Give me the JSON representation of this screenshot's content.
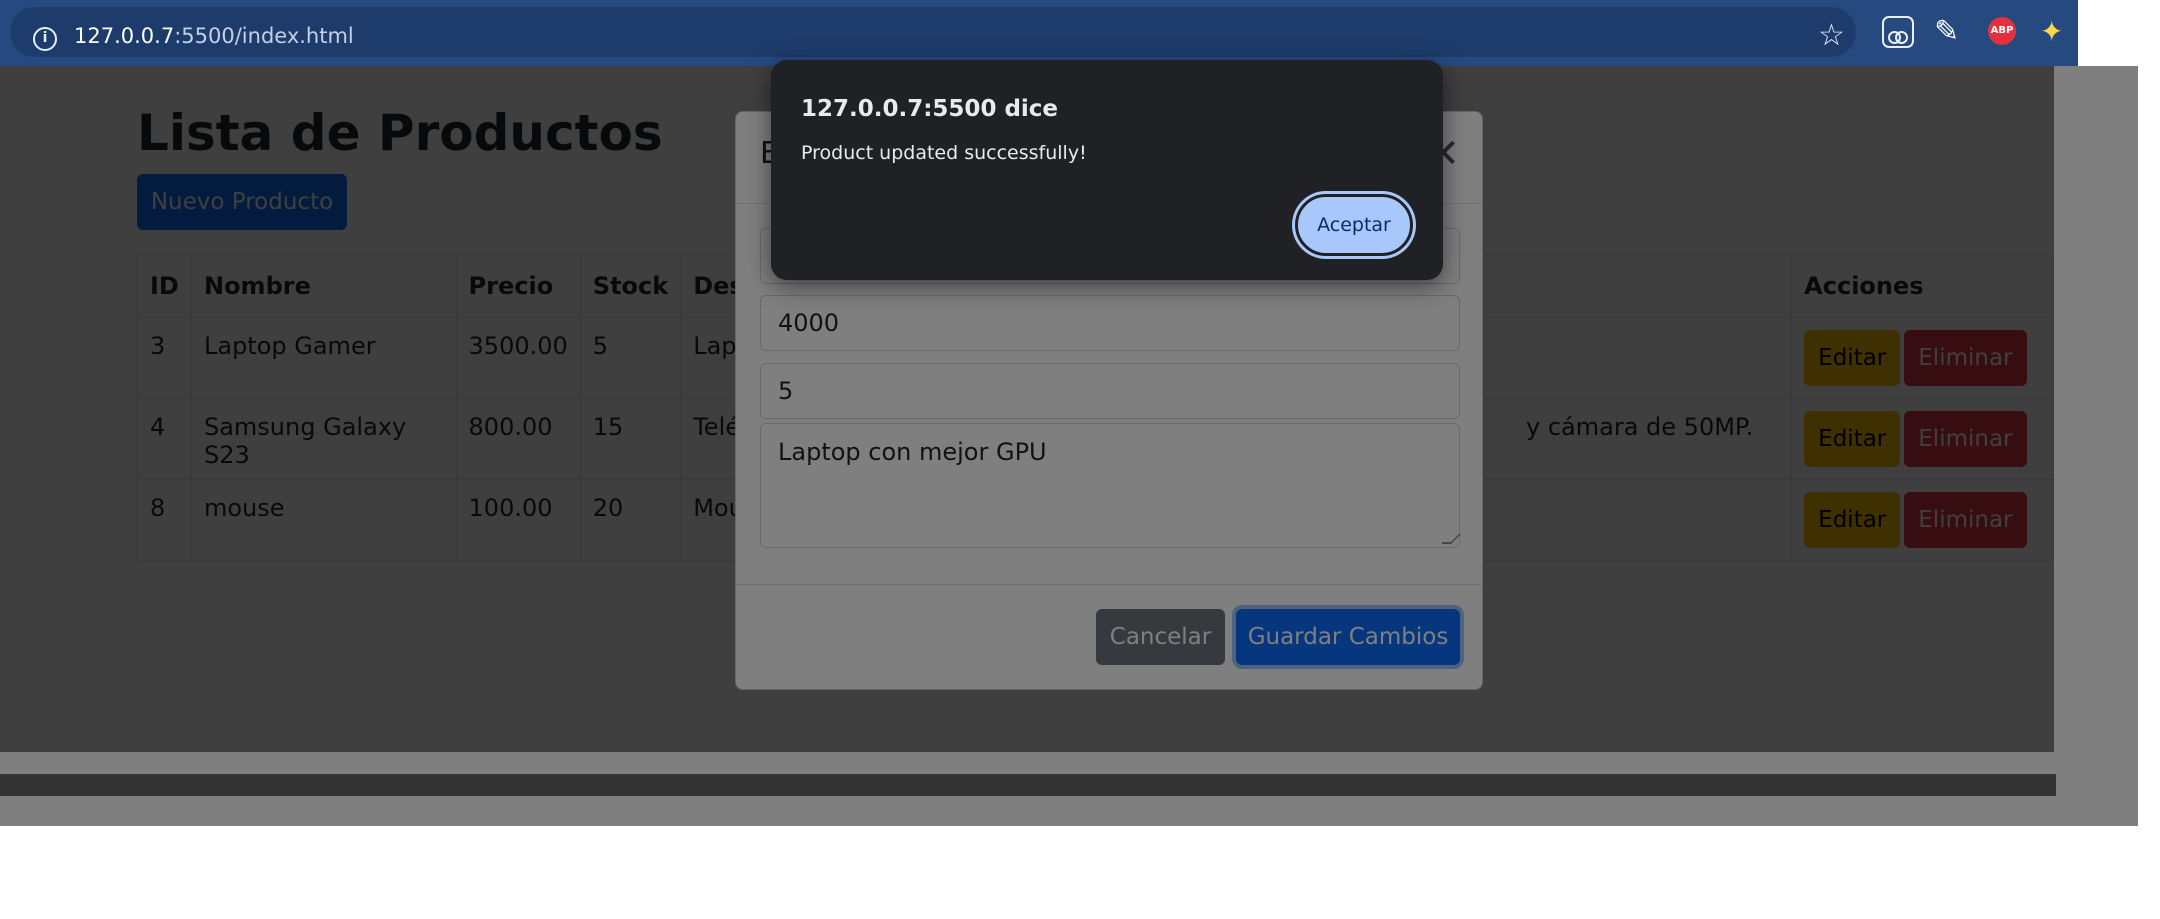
{
  "browser": {
    "url_host": "127.0.0.7",
    "url_rest": ":5500/index.html",
    "icons": [
      "info-icon",
      "star-icon",
      "glasses-extension-icon",
      "eyedropper-extension-icon",
      "adblock-extension-icon",
      "puzzle-extension-icon",
      "menu-icon"
    ],
    "abp_label": "ABP"
  },
  "page": {
    "title": "Lista de Productos",
    "new_button": "Nuevo Producto",
    "table": {
      "headers": [
        "ID",
        "Nombre",
        "Precio",
        "Stock",
        "Desc",
        "Acciones"
      ],
      "rows": [
        {
          "id": "3",
          "name": "Laptop Gamer",
          "price": "3500.00",
          "stock": "5",
          "desc": "Lapt"
        },
        {
          "id": "4",
          "name": "Samsung Galaxy S23",
          "price": "800.00",
          "stock": "15",
          "desc": "Teléf",
          "desc_tail": "y cámara de 50MP."
        },
        {
          "id": "8",
          "name": "mouse",
          "price": "100.00",
          "stock": "20",
          "desc": "Mou"
        }
      ],
      "edit_label": "Editar",
      "delete_label": "Eliminar"
    }
  },
  "modal": {
    "title": "E",
    "close_symbol": "✕",
    "fields": {
      "name": "",
      "price": "4000",
      "stock": "5",
      "description": "Laptop con mejor GPU"
    },
    "cancel_label": "Cancelar",
    "save_label": "Guardar Cambios"
  },
  "alert": {
    "title": "127.0.0.7:5500 dice",
    "message": "Product updated successfully!",
    "ok_label": "Aceptar"
  },
  "colors": {
    "chrome_bar": "#264a80",
    "primary": "#0d6efd",
    "warning": "#ffc107",
    "danger": "#dc3545",
    "dialog_bg": "#202124",
    "dialog_button": "#a8c7fa"
  }
}
